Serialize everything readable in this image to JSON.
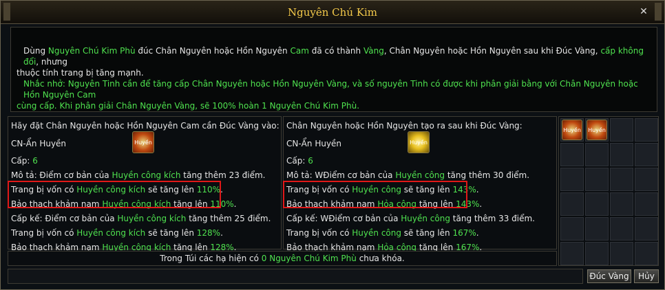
{
  "window": {
    "title": "Nguyên Chú Kim",
    "close_label": "✕"
  },
  "description": {
    "line1": [
      {
        "text": "Dùng ",
        "color": "w"
      },
      {
        "text": "Nguyên Chú Kim Phù",
        "color": "g"
      },
      {
        "text": " đúc Chân Nguyên hoặc Hồn Nguyên ",
        "color": "w"
      },
      {
        "text": "Cam",
        "color": "g"
      },
      {
        "text": " đã có thành ",
        "color": "w"
      },
      {
        "text": "Vàng",
        "color": "g"
      },
      {
        "text": ", Chân Nguyên hoặc Hồn Nguyên sau khi Đúc Vàng, ",
        "color": "w"
      },
      {
        "text": "cấp không đổi",
        "color": "g"
      },
      {
        "text": ", nhưng",
        "color": "w"
      }
    ],
    "line2": [
      {
        "text": "thuộc tính trang bị tăng mạnh.",
        "color": "w"
      }
    ],
    "line3": "Nhắc nhở: Nguyên Tinh cần để tăng cấp Chân Nguyên hoặc Hồn Nguyên Vàng, và số nguyên Tinh có được khi phân giải bằng với Chân Nguyên hoặc Hồn Nguyên Cam",
    "line4": "cùng cấp. Khi phân giải Chân Nguyên Vàng, sẽ 100% hoàn 1 Nguyên Chú Kim Phù."
  },
  "left_panel": {
    "header": "Hãy đặt Chân Nguyên hoặc Hồn Nguyên Cam cần Đúc Vàng vào:",
    "item_name": "CN-Ẩn Huyền",
    "item_icon_text": "Huyền",
    "level_label": "Cấp: ",
    "level_value": "6",
    "desc": [
      {
        "text": "Mô tả: Điểm cơ bản của ",
        "color": "w"
      },
      {
        "text": "Huyền công kích",
        "color": "g"
      },
      {
        "text": " tăng thêm 23 điểm.",
        "color": "w"
      }
    ],
    "equip": [
      {
        "text": "Trang bị vốn có ",
        "color": "w"
      },
      {
        "text": "Huyền công kích",
        "color": "g"
      },
      {
        "text": " sẽ tăng lên ",
        "color": "w"
      },
      {
        "text": "110%",
        "color": "g"
      },
      {
        "text": ".",
        "color": "w"
      }
    ],
    "gem": [
      {
        "text": "Bảo thạch khảm nạm ",
        "color": "w"
      },
      {
        "text": "Huyền công kích",
        "color": "g"
      },
      {
        "text": " tăng lên ",
        "color": "w"
      },
      {
        "text": "110%",
        "color": "g"
      },
      {
        "text": ".",
        "color": "w"
      }
    ],
    "next": [
      {
        "text": "Cấp kế: Điểm cơ bản của ",
        "color": "w"
      },
      {
        "text": "Huyền công kích",
        "color": "g"
      },
      {
        "text": " tăng thêm 25 điểm.",
        "color": "w"
      }
    ],
    "next_equip": [
      {
        "text": "Trang bị vốn có ",
        "color": "w"
      },
      {
        "text": "Huyền công kích",
        "color": "g"
      },
      {
        "text": " sẽ tăng lên ",
        "color": "w"
      },
      {
        "text": "128%",
        "color": "g"
      },
      {
        "text": ".",
        "color": "w"
      }
    ],
    "next_gem": [
      {
        "text": "Bảo thạch khảm nạm ",
        "color": "w"
      },
      {
        "text": "Huyền công kích",
        "color": "g"
      },
      {
        "text": " tăng lên ",
        "color": "w"
      },
      {
        "text": "128%",
        "color": "g"
      },
      {
        "text": ".",
        "color": "w"
      }
    ]
  },
  "right_panel": {
    "header": "Chân Nguyên hoặc Hồn Nguyên tạo ra sau khi Đúc Vàng:",
    "item_name": "CN-Ẩn Huyền",
    "item_icon_text": "Huyền",
    "level_label": "Cấp: ",
    "level_value": "6",
    "desc": [
      {
        "text": "Mô tả: WĐiểm cơ bản của ",
        "color": "w"
      },
      {
        "text": "Huyền công",
        "color": "g"
      },
      {
        "text": " tăng thêm 30 điểm.",
        "color": "w"
      }
    ],
    "equip": [
      {
        "text": "Trang bị vốn có ",
        "color": "w"
      },
      {
        "text": "Huyền công",
        "color": "g"
      },
      {
        "text": " sẽ tăng lên ",
        "color": "w"
      },
      {
        "text": "143%",
        "color": "g"
      },
      {
        "text": ".",
        "color": "w"
      }
    ],
    "gem": [
      {
        "text": "Bảo thạch khảm nạm ",
        "color": "w"
      },
      {
        "text": "Hỏa công",
        "color": "g"
      },
      {
        "text": " tăng lên ",
        "color": "w"
      },
      {
        "text": "143%",
        "color": "g"
      },
      {
        "text": ".",
        "color": "w"
      }
    ],
    "next": [
      {
        "text": "Cấp kế: WĐiểm cơ bản của ",
        "color": "w"
      },
      {
        "text": "Huyền công",
        "color": "g"
      },
      {
        "text": " tăng thêm 33 điểm.",
        "color": "w"
      }
    ],
    "next_equip": [
      {
        "text": "Trang bị vốn có ",
        "color": "w"
      },
      {
        "text": "Huyền công",
        "color": "g"
      },
      {
        "text": " sẽ tăng lên ",
        "color": "w"
      },
      {
        "text": "167%",
        "color": "g"
      },
      {
        "text": ".",
        "color": "w"
      }
    ],
    "next_gem": [
      {
        "text": "Bảo thạch khảm nạm ",
        "color": "w"
      },
      {
        "text": "Hỏa công",
        "color": "g"
      },
      {
        "text": " tăng lên ",
        "color": "w"
      },
      {
        "text": "167%",
        "color": "g"
      },
      {
        "text": ".",
        "color": "w"
      }
    ]
  },
  "inventory": {
    "items": [
      {
        "slot": 0,
        "label": "Huyền"
      },
      {
        "slot": 1,
        "label": "Huyền"
      }
    ]
  },
  "footer": [
    {
      "text": "Trong Túi các hạ hiện có ",
      "color": "w"
    },
    {
      "text": "0 Nguyên Chú Kim Phù",
      "color": "g"
    },
    {
      "text": " chưa khóa.",
      "color": "w"
    }
  ],
  "buttons": {
    "forge": "Đúc Vàng",
    "cancel": "Hủy"
  },
  "colors": {
    "accent": "#f3c94a",
    "green": "#4fe24f",
    "highlight": "#e01818"
  }
}
